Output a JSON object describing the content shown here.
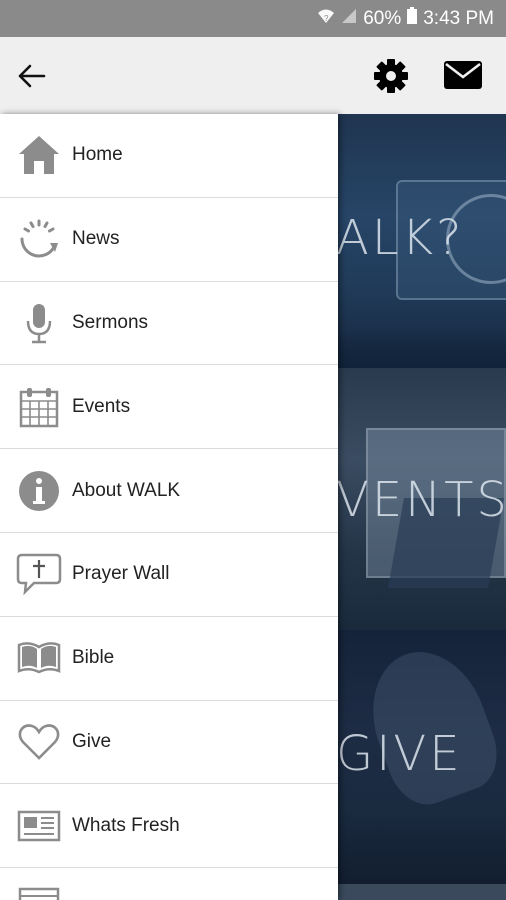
{
  "status_bar": {
    "battery": "60%",
    "time": "3:43 PM",
    "icons": [
      "wifi-icon",
      "signal-icon",
      "battery-icon"
    ]
  },
  "app_bar": {
    "back_icon": "arrow-left-icon",
    "settings_icon": "gear-icon",
    "mail_icon": "envelope-icon"
  },
  "drawer": {
    "items": [
      {
        "label": "Home",
        "icon": "home-icon"
      },
      {
        "label": "News",
        "icon": "refresh-icon"
      },
      {
        "label": "Sermons",
        "icon": "microphone-icon"
      },
      {
        "label": "Events",
        "icon": "calendar-icon"
      },
      {
        "label": "About WALK",
        "icon": "info-icon"
      },
      {
        "label": "Prayer Wall",
        "icon": "cross-chat-icon"
      },
      {
        "label": "Bible",
        "icon": "book-icon"
      },
      {
        "label": "Give",
        "icon": "heart-icon"
      },
      {
        "label": "Whats Fresh",
        "icon": "newspaper-icon"
      }
    ]
  },
  "background_panels": [
    {
      "label": "ALK?"
    },
    {
      "label": "VENTS"
    },
    {
      "label": "GIVE"
    }
  ],
  "colors": {
    "status_bar": "#8a8a8a",
    "app_bar": "#efefef",
    "icon_gray": "#8c8c8c",
    "drawer_bg": "#ffffff"
  }
}
